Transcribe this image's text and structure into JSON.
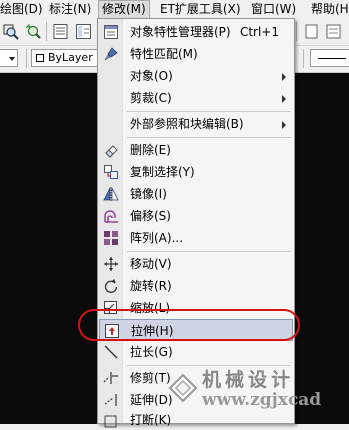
{
  "menubar": {
    "items": [
      {
        "label": "绘图(D)"
      },
      {
        "label": "标注(N)"
      },
      {
        "label": "修改(M)"
      },
      {
        "label": "ET扩展工具(X)"
      },
      {
        "label": "窗口(W)"
      },
      {
        "label": "帮助(H)"
      }
    ]
  },
  "toolbar": {
    "layer_combo": "ByLayer"
  },
  "menu": {
    "items": [
      {
        "label": "对象特性管理器(P)",
        "shortcut": "Ctrl+1",
        "icon": "properties-icon"
      },
      {
        "label": "特性匹配(M)",
        "icon": "match-brush-icon"
      },
      {
        "label": "对象(O)",
        "submenu": true
      },
      {
        "label": "剪裁(C)",
        "submenu": true
      },
      {
        "label": "外部参照和块编辑(B)",
        "submenu": true
      },
      {
        "label": "删除(E)",
        "icon": "eraser-icon"
      },
      {
        "label": "复制选择(Y)",
        "icon": "copy-icon"
      },
      {
        "label": "镜像(I)",
        "icon": "mirror-icon"
      },
      {
        "label": "偏移(S)",
        "icon": "offset-icon"
      },
      {
        "label": "阵列(A)...",
        "icon": "array-icon"
      },
      {
        "label": "移动(V)",
        "icon": "move-icon"
      },
      {
        "label": "旋转(R)",
        "icon": "rotate-icon"
      },
      {
        "label": "缩放(L)",
        "icon": "scale-icon"
      },
      {
        "label": "拉伸(H)",
        "icon": "stretch-icon"
      },
      {
        "label": "拉长(G)",
        "icon": "lengthen-icon"
      },
      {
        "label": "修剪(T)",
        "icon": "trim-icon"
      },
      {
        "label": "延伸(D)",
        "icon": "extend-icon"
      },
      {
        "label": "打断(K)",
        "icon": "break-icon"
      }
    ]
  },
  "watermark": {
    "line1": "机械设计",
    "line2": "www.zgjxcad"
  },
  "colors": {
    "highlight_oval": "#d21414",
    "canvas": "#0a0a0a"
  }
}
